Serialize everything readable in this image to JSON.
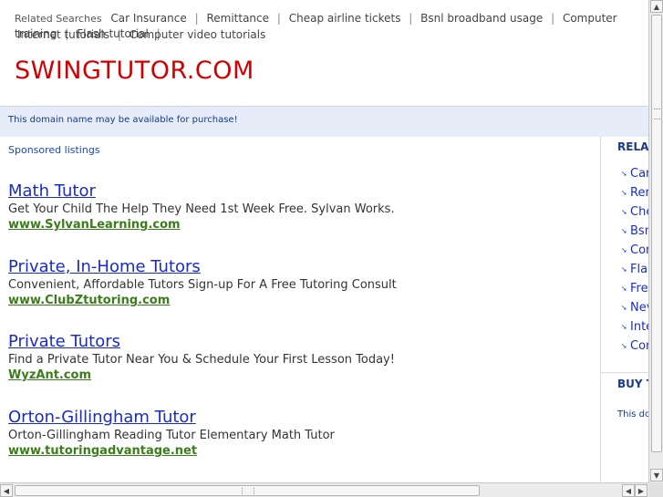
{
  "related_top": {
    "label": "Related Searches",
    "line1": [
      "Car Insurance",
      "Remittance",
      "Cheap airline tickets",
      "Bsnl broadband usage",
      "Computer training",
      "Flash tutorial"
    ],
    "line2": [
      "Internet tutorials",
      "Computer video tutorials"
    ],
    "separator": "|"
  },
  "site_title": "SWINGTUTOR.COM",
  "domain_notice": "This domain name may be available for purchase!",
  "sponsored_label": "Sponsored listings",
  "ads": [
    {
      "title": "Math Tutor",
      "desc": "Get Your Child The Help They Need 1st Week Free. Sylvan Works.",
      "url": "www.SylvanLearning.com"
    },
    {
      "title": "Private, In-Home Tutors",
      "desc": "Convenient, Affordable Tutors Sign-up For A Free Tutoring Consult",
      "url": "www.ClubZtutoring.com"
    },
    {
      "title": "Private Tutors",
      "desc": "Find a Private Tutor Near You & Schedule Your First Lesson Today!",
      "url": "WyzAnt.com"
    },
    {
      "title": "Orton-Gillingham Tutor",
      "desc": "Orton-Gillingham Reading Tutor Elementary Math Tutor",
      "url": "www.tutoringadvantage.net"
    }
  ],
  "sidebar": {
    "heading": "RELA",
    "items": [
      "Car",
      "Rer",
      "Che",
      "Bsn",
      "Cor",
      "Fla",
      "Fre",
      "Nev",
      "Inte",
      "Cor"
    ],
    "buy_heading": "BUY T",
    "buy_text": "This dor"
  },
  "scrollbar": {
    "up_arrow": "▲",
    "down_arrow": "▼",
    "left_arrow": "◀",
    "right_arrow": "▶"
  }
}
